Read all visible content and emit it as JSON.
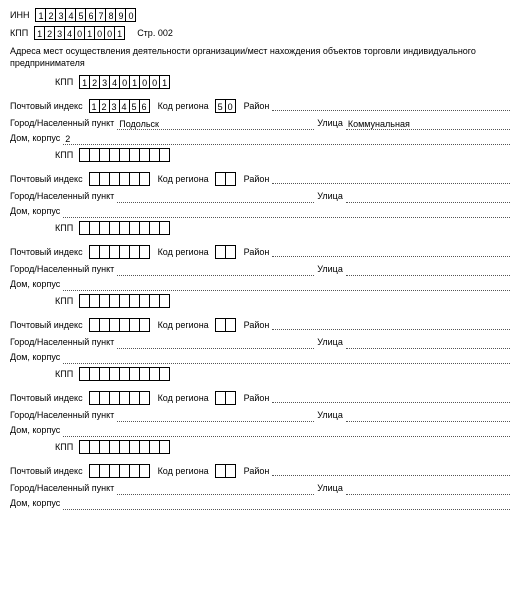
{
  "labels": {
    "inn": "ИНН",
    "kpp": "КПП",
    "page_prefix": "Стр.",
    "page_num": "002",
    "heading": "Адреса мест осуществления деятельности организации/мест нахождения объектов торговли индивидуального предпринимателя",
    "postal": "Почтовый индекс",
    "region_code": "Код региона",
    "district": "Район",
    "city": "Город/Населенный пункт",
    "street": "Улица",
    "house": "Дом, корпус"
  },
  "header": {
    "inn": [
      "1",
      "2",
      "3",
      "4",
      "5",
      "6",
      "7",
      "8",
      "9",
      "0"
    ],
    "kpp": [
      "1",
      "2",
      "3",
      "4",
      "0",
      "1",
      "0",
      "0",
      "1"
    ]
  },
  "blocks": [
    {
      "kpp": [
        "1",
        "2",
        "3",
        "4",
        "0",
        "1",
        "0",
        "0",
        "1"
      ],
      "postal": [
        "1",
        "2",
        "3",
        "4",
        "5",
        "6"
      ],
      "region": [
        "5",
        "0"
      ],
      "district": "",
      "city": "Подольск",
      "street": "Коммунальная",
      "house": "2"
    },
    {
      "kpp": [
        "",
        "",
        "",
        "",
        "",
        "",
        "",
        "",
        ""
      ],
      "postal": [
        "",
        "",
        "",
        "",
        "",
        ""
      ],
      "region": [
        "",
        ""
      ],
      "district": "",
      "city": "",
      "street": "",
      "house": ""
    },
    {
      "kpp": [
        "",
        "",
        "",
        "",
        "",
        "",
        "",
        "",
        ""
      ],
      "postal": [
        "",
        "",
        "",
        "",
        "",
        ""
      ],
      "region": [
        "",
        ""
      ],
      "district": "",
      "city": "",
      "street": "",
      "house": ""
    },
    {
      "kpp": [
        "",
        "",
        "",
        "",
        "",
        "",
        "",
        "",
        ""
      ],
      "postal": [
        "",
        "",
        "",
        "",
        "",
        ""
      ],
      "region": [
        "",
        ""
      ],
      "district": "",
      "city": "",
      "street": "",
      "house": ""
    },
    {
      "kpp": [
        "",
        "",
        "",
        "",
        "",
        "",
        "",
        "",
        ""
      ],
      "postal": [
        "",
        "",
        "",
        "",
        "",
        ""
      ],
      "region": [
        "",
        ""
      ],
      "district": "",
      "city": "",
      "street": "",
      "house": ""
    },
    {
      "kpp": [
        "",
        "",
        "",
        "",
        "",
        "",
        "",
        "",
        ""
      ],
      "postal": [
        "",
        "",
        "",
        "",
        "",
        ""
      ],
      "region": [
        "",
        ""
      ],
      "district": "",
      "city": "",
      "street": "",
      "house": ""
    }
  ]
}
